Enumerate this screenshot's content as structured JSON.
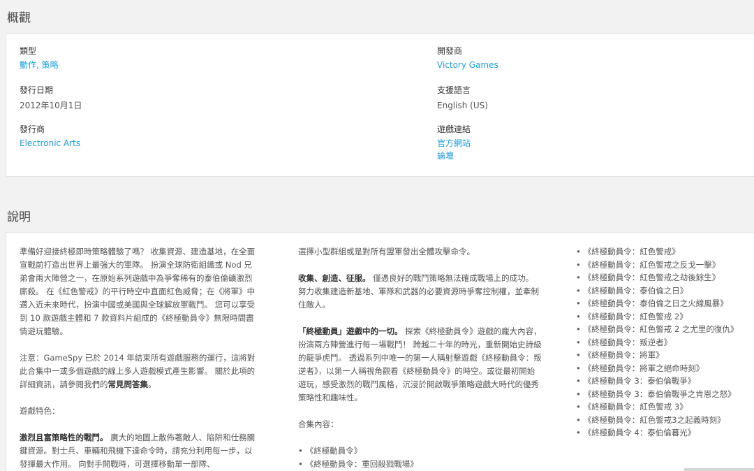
{
  "overview": {
    "title": "概觀",
    "genre_label": "類型",
    "genre_value": "動作, 策略",
    "release_label": "發行日期",
    "release_value": "2012年10月1日",
    "publisher_label": "發行商",
    "publisher_value": "Electronic Arts",
    "developer_label": "開發商",
    "developer_value": "Victory Games",
    "language_label": "支援語言",
    "language_value": "English (US)",
    "links_label": "遊戲連結",
    "links": [
      "官方網站",
      "論壇"
    ]
  },
  "description": {
    "title": "說明",
    "col1": {
      "p1": "準備好迎接終極即時策略體驗了嗎？ 收集資源、建造基地，在全面宣戰前打造出世界上最強大的軍隊。 扮演全球防衛組織或 Nod 兄弟會兩大陣營之一，在原始系列遊戲中為爭奪稀有的泰伯倫礦激烈廝殺。 在《紅色警戒》的平行時空中直面紅色威脅；在《將軍》中邁入近未來時代，扮演中國或美國與全球解放軍戰鬥。 您可以享受到 10 款遊戲主體和 7 款資料片組成的《終極動員令》無限時間盡情遊玩體驗。",
      "p2_prefix": "注意：GameSpy 已於 2014 年結束所有遊戲服務的運行，這將對此合集中一或多個遊戲的線上多人遊戲模式產生影響。 關於此項的詳細資訊，請參閱我們的",
      "p2_link": "常見問答集",
      "p2_suffix": "。",
      "p3": "遊戲特色：",
      "p4_strong": "激烈且富策略性的戰鬥。",
      "p4_rest": " 廣大的地圖上散佈著敵人、陷阱和仕務關鍵資源。對士兵、車輛和飛機下達命令時，請充分利用每一步，以發揮最大作用。 向對手開戰時，可選擇移動單一部隊、"
    },
    "col2": {
      "p1": "選擇小型群組或是對所有盟軍發出全體攻擊命令。",
      "p2_strong": "收集、創造、征服。",
      "p2_rest": " 僅憑良好的戰鬥策略無法確成戰場上的成功。 努力收集建造新基地、軍隊和武器的必要資源時爭奪控制權，並牽制住敵人。",
      "p3_strong": "「終極動員」遊戲中的一切。",
      "p3_rest": " 探索《終極動員令》遊戲的龐大內容，扮演兩方陣營進行每一場戰鬥！ 跨越二十年的時光，重新開始史詩級的龍爭虎鬥。 透過系列中唯一的第一人稱射擊遊戲《終極動員令：叛逆者》，以第一人稱視角觀看《終極動員令》的時空。或從最初開始遊玩，感受激烈的戰鬥風格，沉浸於開啟戰爭策略遊戲大時代的優秀策略性和趣味性。",
      "p4": "合集內容：",
      "items": [
        "《終極動員令》",
        "《終極動員令：重回殺戮戰場》"
      ]
    },
    "col3": {
      "items": [
        "《終極動員令：紅色警戒》",
        "《終極動員令：紅色警戒之反戈一擊》",
        "《終極動員令：紅色警戒之劫後餘生》",
        "《終極動員令：泰伯倫之日》",
        "《終極動員令：泰伯倫之日之火線風暴》",
        "《終極動員令：紅色警戒 2》",
        "《終極動員令：紅色警戒 2 之尤里的復仇》",
        "《終極動員令：叛逆者》",
        "《終極動員令：將軍》",
        "《終極動員令：將軍之絕命時刻》",
        "《終極動員令 3：泰伯倫戰爭》",
        "《終極動員令 3：泰伯倫戰爭之肯恩之怒》",
        "《終極動員令：紅色警戒 3》",
        "《終極動員令：紅色警戒3之起義時刻》",
        "《終極動員令 4：泰伯倫暮光》"
      ]
    }
  },
  "colors": {
    "link": "#1e9ed8",
    "background": "#f2f2f2",
    "card": "#ffffff"
  }
}
